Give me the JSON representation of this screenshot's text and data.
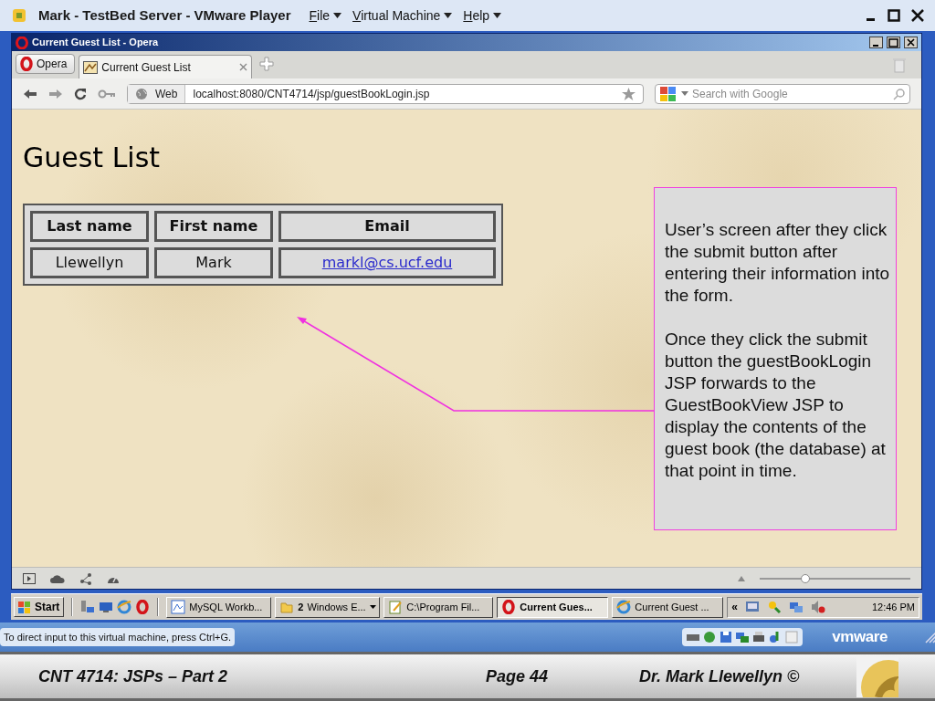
{
  "vm_window": {
    "title": "Mark - TestBed Server - VMware Player",
    "menus": [
      "File",
      "Virtual Machine",
      "Help"
    ]
  },
  "browser": {
    "title": "Current Guest List - Opera",
    "menu_button": "Opera",
    "tabs": [
      {
        "label": "Current Guest List",
        "selected": true
      }
    ],
    "address": {
      "label": "Web",
      "url": "localhost:8080/CNT4714/jsp/guestBookLogin.jsp"
    },
    "search": {
      "placeholder": "Search with Google"
    },
    "zoom": {
      "level": 0.3
    }
  },
  "page": {
    "heading": "Guest List",
    "table": {
      "columns": [
        "Last name",
        "First name",
        "Email"
      ],
      "rows": [
        {
          "last_name": "Llewellyn",
          "first_name": "Mark",
          "email": "markl@cs.ucf.edu"
        }
      ]
    }
  },
  "callout": {
    "paragraphs": [
      "User’s screen after they click the submit button after entering their information into the form.",
      "Once they click the submit button the guestBookLogin JSP forwards to the GuestBookView JSP to display the contents of the guest book (the database) at that point in time."
    ]
  },
  "taskbar": {
    "start": "Start",
    "tasks": [
      {
        "label": "MySQL Workb...",
        "selected": false
      },
      {
        "label": "Windows E...",
        "count": "2",
        "selected": false
      },
      {
        "label": "C:\\Program Fil...",
        "selected": false
      },
      {
        "label": "Current Gues...",
        "selected": true
      },
      {
        "label": "Current Guest ...",
        "selected": false
      }
    ],
    "tray_toggle": "«",
    "clock": "12:46 PM"
  },
  "vm_status": {
    "message": "To direct input to this virtual machine, press Ctrl+G.",
    "logo": "vmware"
  },
  "footer": {
    "course": "CNT 4714: JSPs – Part 2",
    "page": "Page 44",
    "author": "Dr. Mark Llewellyn ©"
  }
}
